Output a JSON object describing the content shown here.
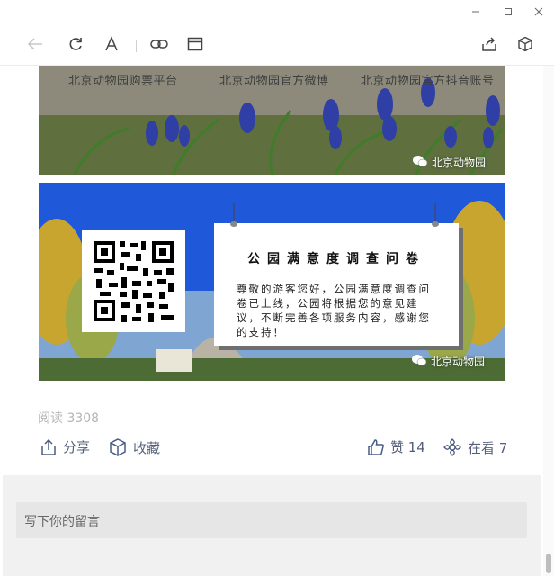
{
  "window": {
    "controls": [
      "minimize-icon",
      "maximize-icon",
      "close-icon"
    ]
  },
  "toolbar": {
    "icons": [
      "back-arrow-icon",
      "refresh-icon",
      "font-size-icon",
      "link-icon",
      "window-icon",
      "share-icon",
      "cube-icon"
    ]
  },
  "article": {
    "banner1": {
      "labels": [
        "北京动物园购票平台",
        "北京动物园官方微博",
        "北京动物园官方抖音账号"
      ],
      "watermark": "北京动物园"
    },
    "banner2": {
      "title": "公园满意度调查问卷",
      "body": "尊敬的游客您好，公园满意度调查问卷已上线，公园将根据您的意见建议，不断完善各项服务内容，感谢您的支持！",
      "watermark": "北京动物园"
    },
    "read_count": "阅读 3308"
  },
  "actions": {
    "share": "分享",
    "favorite": "收藏",
    "like": "赞 14",
    "watching": "在看 7"
  },
  "comment": {
    "placeholder": "写下你的留言"
  },
  "colors": {
    "accent": "#4a5b86",
    "sky": "#1e56d6"
  }
}
